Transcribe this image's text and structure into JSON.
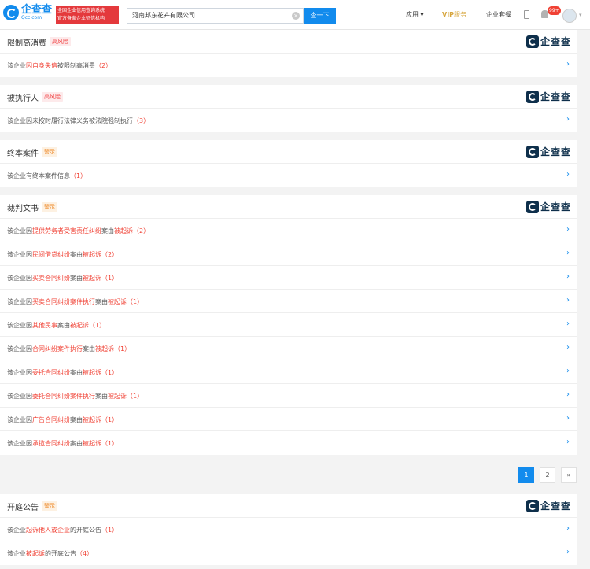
{
  "header": {
    "logo_cn": "企查查",
    "logo_en": "Qcc.com",
    "badge_line1": "全国企业信用查询系统",
    "badge_line2": "官方备案企业征信机构",
    "search_value": "河南邦东花卉有限公司",
    "clear_glyph": "×",
    "search_button": "查一下",
    "nav_apps": "应用 ▾",
    "vip_word": "VIP",
    "vip_service": "服务",
    "nav_package": "企业套餐",
    "notif_count": "99+",
    "avatar_caret": "▾"
  },
  "brand": {
    "text": "企查查"
  },
  "chevron": "›",
  "sections": {
    "restrict": {
      "title": "限制高消费",
      "tag": "高风险",
      "rows": [
        {
          "pre": "该企业",
          "hl": "因自身失信",
          "post": "被限制高消费",
          "count": "（2）"
        }
      ]
    },
    "executed": {
      "title": "被执行人",
      "tag": "高风险",
      "rows": [
        {
          "pre": "该企业因未按时履行法律义务被法院强制执行",
          "hl": "",
          "post": "",
          "count": "（3）"
        }
      ]
    },
    "final": {
      "title": "终本案件",
      "tag": "警示",
      "rows": [
        {
          "pre": "该企业有终本案件信息",
          "hl": "",
          "post": "",
          "count": "（1）"
        }
      ]
    },
    "judgment": {
      "title": "裁判文书",
      "tag": "警示",
      "rows": [
        {
          "pre": "该企业因",
          "hl": "提供劳务者受害责任纠纷",
          "post": "案由",
          "hl2": "被起诉",
          "count": "（2）"
        },
        {
          "pre": "该企业因",
          "hl": "民间借贷纠纷",
          "post": "案由",
          "hl2": "被起诉",
          "count": "（2）"
        },
        {
          "pre": "该企业因",
          "hl": "买卖合同纠纷",
          "post": "案由",
          "hl2": "被起诉",
          "count": "（1）"
        },
        {
          "pre": "该企业因",
          "hl": "买卖合同纠纷案件执行",
          "post": "案由",
          "hl2": "被起诉",
          "count": "（1）"
        },
        {
          "pre": "该企业因",
          "hl": "其他民事",
          "post": "案由",
          "hl2": "被起诉",
          "count": "（1）"
        },
        {
          "pre": "该企业因",
          "hl": "合同纠纷案件执行",
          "post": "案由",
          "hl2": "被起诉",
          "count": "（1）"
        },
        {
          "pre": "该企业因",
          "hl": "委托合同纠纷",
          "post": "案由",
          "hl2": "被起诉",
          "count": "（1）"
        },
        {
          "pre": "该企业因",
          "hl": "委托合同纠纷案件执行",
          "post": "案由",
          "hl2": "被起诉",
          "count": "（1）"
        },
        {
          "pre": "该企业因",
          "hl": "广告合同纠纷",
          "post": "案由",
          "hl2": "被起诉",
          "count": "（1）"
        },
        {
          "pre": "该企业因",
          "hl": "承揽合同纠纷",
          "post": "案由",
          "hl2": "被起诉",
          "count": "（1）"
        }
      ]
    },
    "court": {
      "title": "开庭公告",
      "tag": "警示",
      "rows": [
        {
          "pre": "该企业",
          "hl": "起诉他人或企业",
          "post": "的开庭公告",
          "count": "（1）"
        },
        {
          "pre": "该企业",
          "hl": "被起诉",
          "post": "的开庭公告",
          "count": "（4）"
        }
      ]
    }
  },
  "pagination": {
    "page1": "1",
    "page2": "2",
    "next": "»"
  }
}
